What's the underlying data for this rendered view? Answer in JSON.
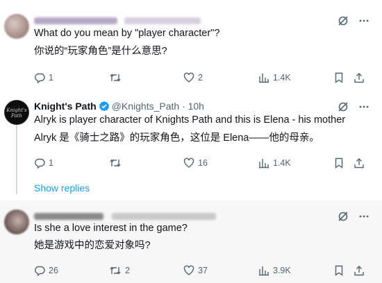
{
  "replies": [
    {
      "text_en": "What do you mean by \"player character\"?",
      "text_zh": "你说的“玩家角色”是什么意思?",
      "stats": {
        "replies": "1",
        "retweets": "",
        "likes": "2",
        "views": "1.4K"
      }
    },
    {
      "name": "Knight's Path",
      "handle": "@Knights_Path",
      "time": "· 10h",
      "avatar_text": "Knight's Path",
      "text_en": "Alryk is player character of Knights Path and this is Elena - his mother",
      "text_zh": "Alryk 是《骑士之路》的玩家角色，这位是 Elena——他的母亲。",
      "stats": {
        "replies": "1",
        "retweets": "",
        "likes": "16",
        "views": "1.4K"
      }
    },
    {
      "text_en": "Is she a love interest in the game?",
      "text_zh": "她是游戏中的恋爱对象吗?",
      "stats": {
        "replies": "26",
        "retweets": "2",
        "likes": "37",
        "views": "3.9K"
      }
    }
  ],
  "show_replies": "Show replies",
  "colors": {
    "accent": "#1d9bf0",
    "muted": "#536471",
    "verified": "#1d9bf0"
  },
  "icons": [
    "grok-icon",
    "more-icon",
    "reply-icon",
    "retweet-icon",
    "like-icon",
    "views-icon",
    "bookmark-icon",
    "share-icon",
    "verified-badge-icon"
  ]
}
